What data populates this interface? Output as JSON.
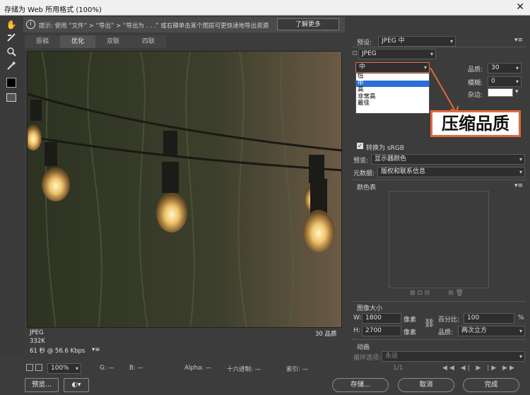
{
  "window": {
    "title": "存储为 Web 所用格式 (100%)",
    "close": "✕"
  },
  "hint": {
    "text": "提示:  使用 “文件” > “导出” > “导出为 . . .” 或右键单击某个图层可更快速地导出资源",
    "more_button": "了解更多"
  },
  "tabs": [
    {
      "label": "原稿",
      "active": false
    },
    {
      "label": "优化",
      "active": true
    },
    {
      "label": "双联",
      "active": false
    },
    {
      "label": "四联",
      "active": false
    }
  ],
  "image_stats": {
    "format": "JPEG",
    "size": "332K",
    "time": "61 秒 @ 56.6 Kbps",
    "quality_note": "30 品质"
  },
  "status": {
    "zoom": "100%",
    "r": "G: —",
    "b": "B: —",
    "alpha": "Alpha: —",
    "hex": "十六进制: —",
    "index": "索引: —"
  },
  "footer": {
    "preview": "预览...",
    "save": "存储...",
    "cancel": "取消",
    "done": "完成"
  },
  "panel": {
    "preset_label": "预设:",
    "preset_value": "JPEG 中",
    "format_value": "JPEG",
    "compression_value": "中",
    "compression_options": [
      {
        "label": "低",
        "selected": false
      },
      {
        "label": "中",
        "selected": true
      },
      {
        "label": "高",
        "selected": false
      },
      {
        "label": "非常高",
        "selected": false
      },
      {
        "label": "最佳",
        "selected": false
      }
    ],
    "quality_label": "品质:",
    "quality_value": "30",
    "blur_label": "模糊:",
    "blur_value": "0",
    "matte_label": "杂边:",
    "callout": "压缩品质",
    "convert_label": "转换为 sRGB",
    "preview_label": "预览:",
    "preview_value": "显示器颜色",
    "metadata_label": "元数据:",
    "metadata_value": "版权和联系信息",
    "colortable_label": "颜色表",
    "imagesize_label": "图像大小",
    "w_label": "W:",
    "w_value": "1800",
    "h_label": "H:",
    "h_value": "2700",
    "px_unit": "像素",
    "percent_label": "百分比:",
    "percent_value": "100",
    "percent_unit": "%",
    "quality2_label": "品质:",
    "quality2_value": "两次立方",
    "animation_label": "动画",
    "loop_label": "循环选项:",
    "loop_value": "永远",
    "frame_counter": "1/1"
  },
  "colors": {
    "accent": "#e06a3a",
    "selection": "#2a6fd6"
  }
}
